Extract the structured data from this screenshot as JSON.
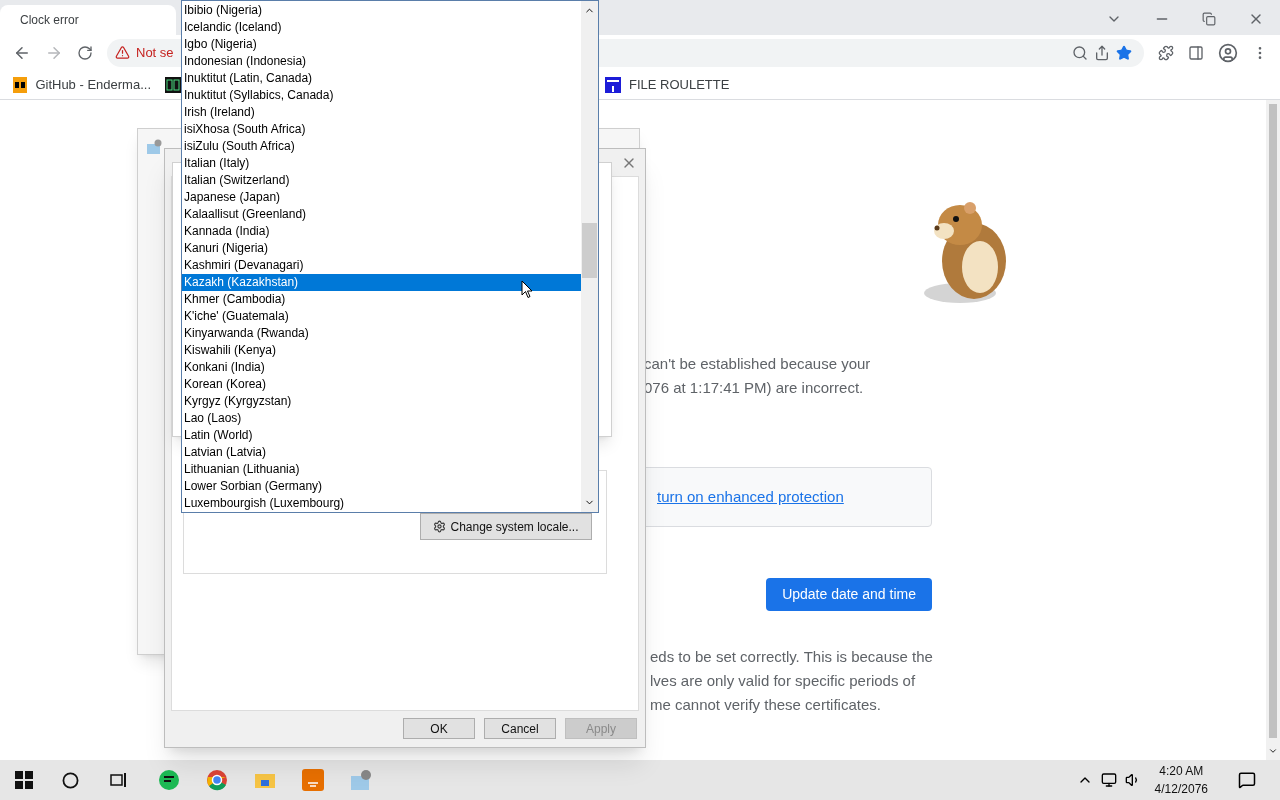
{
  "browser": {
    "tab_title": "Clock error",
    "address_warning": "Not se",
    "bookmarks": [
      {
        "label": "GitHub - Enderma...",
        "kind": "ph"
      },
      {
        "kind": "counter"
      },
      {
        "label": "FILE ROULETTE",
        "kind": "mft"
      }
    ]
  },
  "page": {
    "intro_lines": [
      "can't be established because your",
      "076 at 1:17:41 PM) are incorrect."
    ],
    "protection_link": "turn on enhanced protection",
    "update_button": "Update date and time",
    "explanation_lines": [
      "eds to be set correctly. This is because the",
      "lves are only valid for specific periods of",
      "me cannot verify these certificates."
    ]
  },
  "dialog": {
    "locale_button": "Change system locale...",
    "buttons": [
      {
        "label": "OK",
        "disabled": false
      },
      {
        "label": "Cancel",
        "disabled": false
      },
      {
        "label": "Apply",
        "disabled": true
      }
    ]
  },
  "locale_list": [
    {
      "label": "Ibibio (Nigeria)",
      "selected": false
    },
    {
      "label": "Icelandic (Iceland)",
      "selected": false
    },
    {
      "label": "Igbo (Nigeria)",
      "selected": false
    },
    {
      "label": "Indonesian (Indonesia)",
      "selected": false
    },
    {
      "label": "Inuktitut (Latin, Canada)",
      "selected": false
    },
    {
      "label": "Inuktitut (Syllabics, Canada)",
      "selected": false
    },
    {
      "label": "Irish (Ireland)",
      "selected": false
    },
    {
      "label": "isiXhosa (South Africa)",
      "selected": false
    },
    {
      "label": "isiZulu (South Africa)",
      "selected": false
    },
    {
      "label": "Italian (Italy)",
      "selected": false
    },
    {
      "label": "Italian (Switzerland)",
      "selected": false
    },
    {
      "label": "Japanese (Japan)",
      "selected": false
    },
    {
      "label": "Kalaallisut (Greenland)",
      "selected": false
    },
    {
      "label": "Kannada (India)",
      "selected": false
    },
    {
      "label": "Kanuri (Nigeria)",
      "selected": false
    },
    {
      "label": "Kashmiri (Devanagari)",
      "selected": false
    },
    {
      "label": "Kazakh (Kazakhstan)",
      "selected": true
    },
    {
      "label": "Khmer (Cambodia)",
      "selected": false
    },
    {
      "label": "K'iche' (Guatemala)",
      "selected": false
    },
    {
      "label": "Kinyarwanda (Rwanda)",
      "selected": false
    },
    {
      "label": "Kiswahili (Kenya)",
      "selected": false
    },
    {
      "label": "Konkani (India)",
      "selected": false
    },
    {
      "label": "Korean (Korea)",
      "selected": false
    },
    {
      "label": "Kyrgyz (Kyrgyzstan)",
      "selected": false
    },
    {
      "label": "Lao (Laos)",
      "selected": false
    },
    {
      "label": "Latin (World)",
      "selected": false
    },
    {
      "label": "Latvian (Latvia)",
      "selected": false
    },
    {
      "label": "Lithuanian (Lithuania)",
      "selected": false
    },
    {
      "label": "Lower Sorbian (Germany)",
      "selected": false
    },
    {
      "label": "Luxembourgish (Luxembourg)",
      "selected": false
    }
  ],
  "taskbar": {
    "time": "4:20 AM",
    "date": "4/12/2076"
  }
}
